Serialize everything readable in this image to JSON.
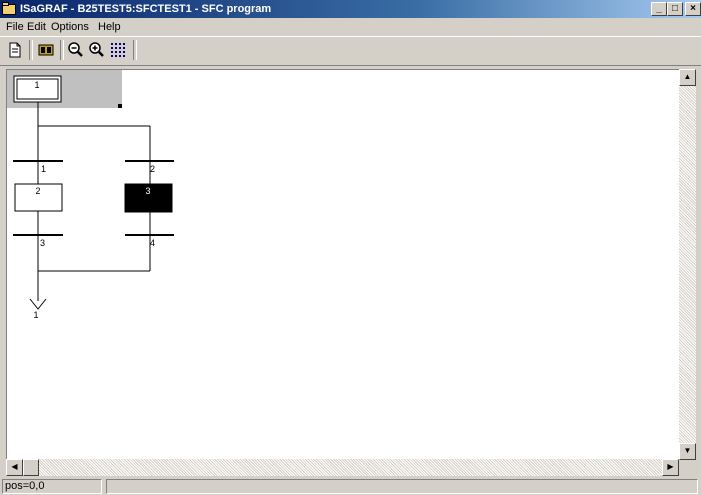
{
  "window": {
    "title": "ISaGRAF - B25TEST5:SFCTEST1 - SFC program",
    "minimize_label": "_",
    "maximize_label": "□",
    "close_label": "×"
  },
  "menu": {
    "file": "File",
    "edit": "Edit",
    "options": "Options",
    "help": "Help"
  },
  "toolbar": {
    "icons": [
      "document-icon",
      "step-insert-icon",
      "zoom-out-icon",
      "zoom-in-icon",
      "grid-icon"
    ]
  },
  "sfc": {
    "initial_step": "1",
    "transition_1": "1",
    "transition_2": "2",
    "step_2": "2",
    "step_3": "3",
    "transition_3": "3",
    "transition_4": "4",
    "jump_target": "1"
  },
  "colors": {
    "titlebar_start": "#0a246a",
    "titlebar_end": "#a6caf0",
    "active_step": "#000000",
    "selection": "#c0c0c0"
  },
  "status": {
    "position": "pos=0,0",
    "message": ""
  }
}
